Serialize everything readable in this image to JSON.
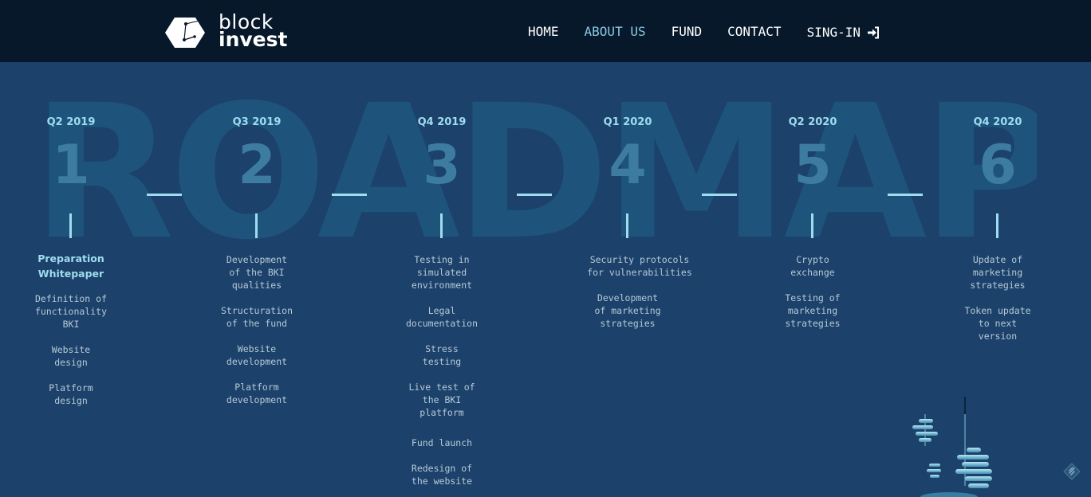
{
  "brand": {
    "line1": "block",
    "line2": "invest"
  },
  "nav": {
    "items": [
      {
        "label": "HOME",
        "active": false
      },
      {
        "label": "ABOUT US",
        "active": true
      },
      {
        "label": "FUND",
        "active": false
      },
      {
        "label": "CONTACT",
        "active": false
      },
      {
        "label": "SING-IN",
        "active": false
      }
    ],
    "active_color": "#87c8e0"
  },
  "watermark": "ROADMAP",
  "roadmap": [
    {
      "date": "Q2 2019",
      "number": "1",
      "items": [
        "Preparation Whitepaper",
        "Definition of functionality BKI",
        "Website design",
        "Platform design"
      ]
    },
    {
      "date": "Q3 2019",
      "number": "2",
      "items": [
        "Development of the BKI qualities",
        "Structuration of the fund",
        "Website development",
        "Platform development"
      ]
    },
    {
      "date": "Q4 2019",
      "number": "3",
      "items": [
        "Testing in simulated environment",
        "Legal documentation",
        "Stress testing",
        "Live test of the BKI platform",
        "Fund launch",
        "Redesign of the website"
      ]
    },
    {
      "date": "Q1 2020",
      "number": "4",
      "items": [
        "Security protocols for vulnerabilities",
        "Development of marketing strategies"
      ]
    },
    {
      "date": "Q2 2020",
      "number": "5",
      "items": [
        "Crypto exchange",
        "Testing of marketing strategies"
      ]
    },
    {
      "date": "Q4 2020",
      "number": "6",
      "items": [
        "Update of marketing strategies",
        "Token update to next version"
      ]
    }
  ],
  "colors": {
    "background": "#1c416a",
    "navbar": "#07182b",
    "accent": "#9fdcef"
  }
}
